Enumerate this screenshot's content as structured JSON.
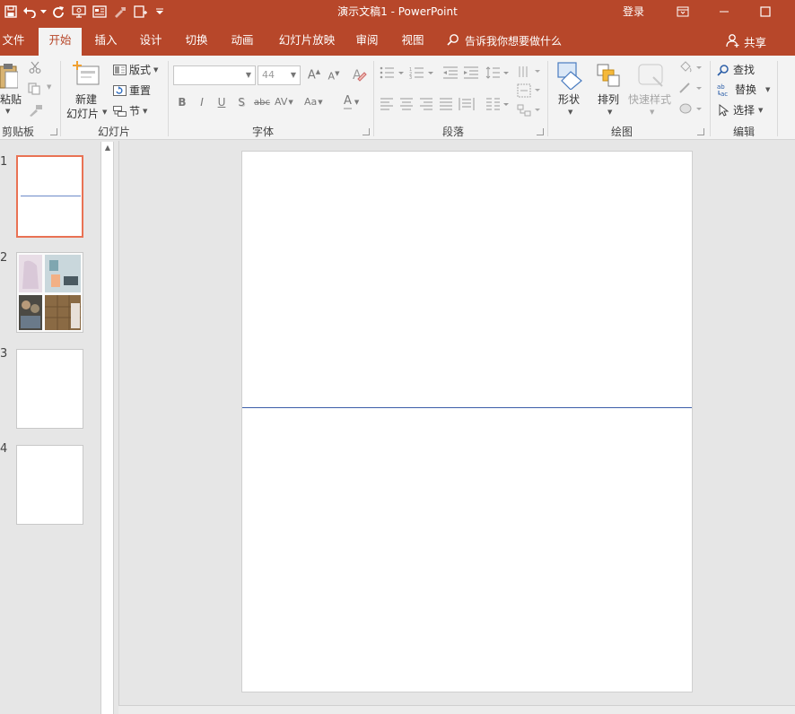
{
  "window": {
    "title": "演示文稿1  -  PowerPoint",
    "login_label": "登录"
  },
  "qat": {
    "icons": [
      "save-icon",
      "undo-icon",
      "undo-dropdown-icon",
      "redo-icon",
      "slideshow-from-start-icon",
      "presenter-icon",
      "format-painter-icon",
      "new-slide-icon",
      "customize-qat-icon"
    ]
  },
  "tabs": [
    {
      "label": "文件"
    },
    {
      "label": "开始",
      "active": true
    },
    {
      "label": "插入"
    },
    {
      "label": "设计"
    },
    {
      "label": "切换"
    },
    {
      "label": "动画"
    },
    {
      "label": "幻灯片放映"
    },
    {
      "label": "审阅"
    },
    {
      "label": "视图"
    }
  ],
  "tellme": {
    "placeholder": "告诉我你想要做什么"
  },
  "share": {
    "label": "共享"
  },
  "ribbon": {
    "clipboard": {
      "paste_label": "粘贴",
      "group_label": "剪贴板"
    },
    "slides": {
      "new_slide_line1": "新建",
      "new_slide_line2": "幻灯片",
      "layout_label": "版式",
      "reset_label": "重置",
      "section_label": "节",
      "group_label": "幻灯片"
    },
    "font": {
      "font_name_value": "",
      "font_size_value": "44",
      "bold": "B",
      "italic": "I",
      "underline": "U",
      "shadow": "S",
      "strike": "abc",
      "spacing": "AV",
      "case": "Aa",
      "color": "A",
      "grow": "A",
      "shrink": "A",
      "group_label": "字体"
    },
    "paragraph": {
      "group_label": "段落"
    },
    "drawing": {
      "shapes_label": "形状",
      "arrange_label": "排列",
      "quick_styles_label": "快速样式",
      "group_label": "绘图"
    },
    "editing": {
      "find_label": "查找",
      "replace_label": "替换",
      "select_label": "选择",
      "group_label": "编辑"
    }
  },
  "slides": [
    {
      "number": "1"
    },
    {
      "number": "2"
    },
    {
      "number": "3"
    },
    {
      "number": "4"
    }
  ],
  "colors": {
    "accent": "#b7472a",
    "ribbon_bg": "#f3f3f3",
    "selected_thumb_border": "#e97254",
    "slide_line": "#3c5ea8"
  }
}
